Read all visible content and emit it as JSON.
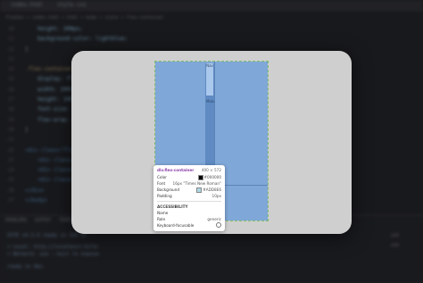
{
  "editor": {
    "tabs": [
      "index.html",
      "style.css"
    ],
    "breadcrumb": "flexbox > index.html > html > body > style > flex-container",
    "code_lines": [
      {
        "num": "10",
        "text": "height: 200px;"
      },
      {
        "num": "11",
        "text": "background-color: lightblue;"
      },
      {
        "num": "12",
        "text": "}"
      },
      {
        "num": "13",
        "text": ""
      },
      {
        "num": "14",
        "text": ".flex-container {"
      },
      {
        "num": "15",
        "text": "display: flex;"
      },
      {
        "num": "16",
        "text": "width: 100%;"
      },
      {
        "num": "17",
        "text": "height: 100%;"
      },
      {
        "num": "18",
        "text": "font-size: 16px;"
      },
      {
        "num": "19",
        "text": "flex-wrap: wrap;"
      },
      {
        "num": "20",
        "text": "}"
      },
      {
        "num": "21",
        "text": ""
      },
      {
        "num": "22",
        "text": "<div class=\"flex-container\">"
      },
      {
        "num": "23",
        "text": "<div class=\"item\"></div>"
      },
      {
        "num": "24",
        "text": "<div class=\"item\"></div>"
      },
      {
        "num": "25",
        "text": "<div class=\"item\"></div>"
      },
      {
        "num": "26",
        "text": "</div>"
      },
      {
        "num": "27",
        "text": "</body>"
      }
    ],
    "panel_tabs": "PROBLEMS   OUTPUT   TERMINAL",
    "terminal_lines": [
      "VITE v4.3.9  ready in 330 ms",
      "➜  Local:   http://localhost:5173/",
      "➜  Network: use --host to expose",
      "ready in 9ms."
    ],
    "side_items": [
      "zsh",
      "zsh"
    ]
  },
  "preview": {
    "column_top_label": "Nav",
    "column_mid_label": "Main"
  },
  "tooltip": {
    "element": "div.flex-container",
    "size": "400 × 572",
    "props": [
      {
        "label": "Color",
        "value": "#000000",
        "swatch": "#000000"
      },
      {
        "label": "Font",
        "value": "16px \"Times New Roman\"",
        "swatch": ""
      },
      {
        "label": "Background",
        "value": "#ADD8E6",
        "swatch": "#ADD8E6"
      },
      {
        "label": "Padding",
        "value": "10px",
        "swatch": ""
      }
    ],
    "section": "ACCESSIBILITY",
    "a11y": [
      {
        "label": "Name",
        "value": ""
      },
      {
        "label": "Role",
        "value": "generic"
      },
      {
        "label": "Keyboard-focusable",
        "value": ""
      }
    ]
  },
  "colors": {
    "preview_bg": "#7fa7d7",
    "card_bg": "#cfcfcf",
    "tooltip_title": "#8b3fa8"
  }
}
